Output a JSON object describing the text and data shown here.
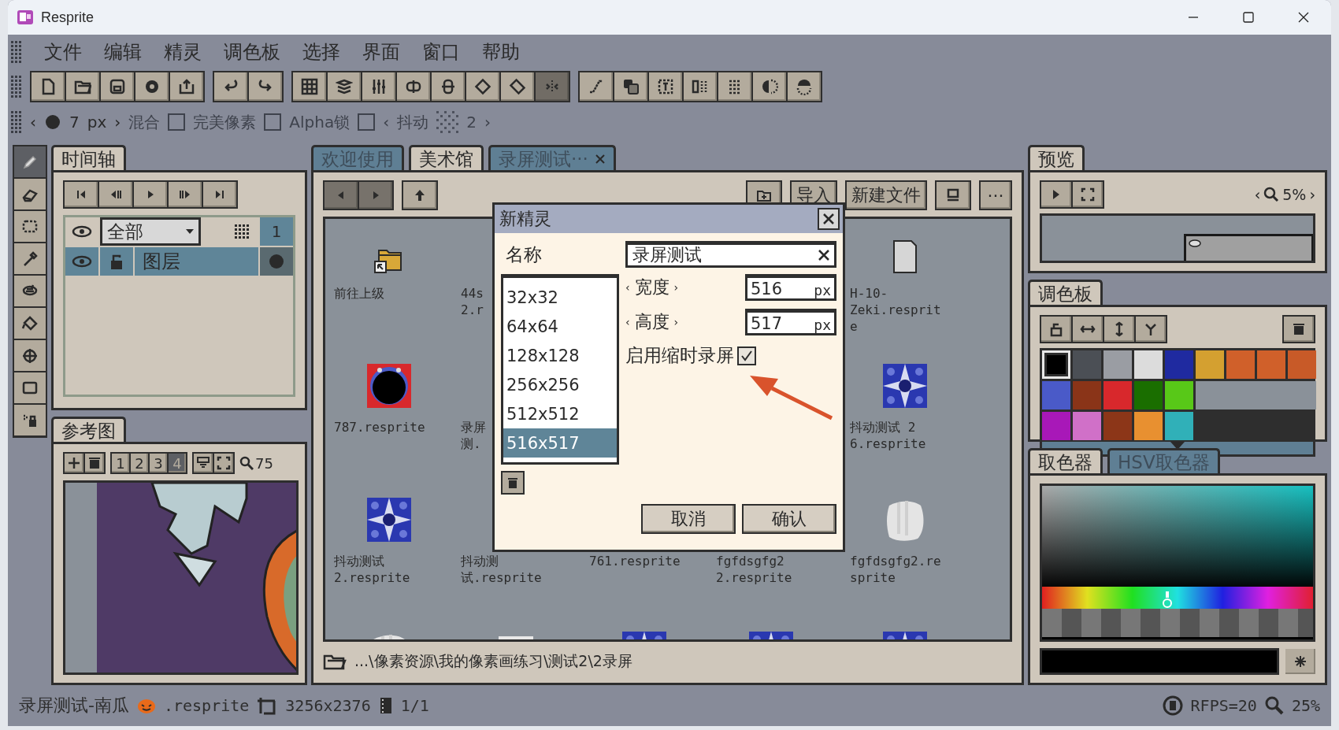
{
  "window": {
    "title": "Resprite"
  },
  "menu": [
    "文件",
    "编辑",
    "精灵",
    "调色板",
    "选择",
    "界面",
    "窗口",
    "帮助"
  ],
  "toolbar": [
    [
      {
        "disabled": false
      },
      {
        "disabled": false
      },
      {
        "disabled": false
      },
      {
        "disabled": false
      },
      {
        "disabled": false
      }
    ],
    [
      {
        "disabled": false
      },
      {
        "disabled": false
      }
    ],
    [
      {
        "disabled": false
      },
      {
        "disabled": false
      },
      {
        "disabled": false
      },
      {
        "disabled": false
      },
      {
        "disabled": false
      },
      {
        "disabled": false
      },
      {
        "disabled": false
      },
      {
        "disabled": true
      }
    ],
    [
      {
        "disabled": false
      },
      {
        "disabled": false
      },
      {
        "disabled": false
      },
      {
        "disabled": false
      },
      {
        "disabled": false
      },
      {
        "disabled": false
      },
      {
        "disabled": false
      }
    ]
  ],
  "options": {
    "arrows": [
      "‹",
      "›"
    ],
    "size": "7",
    "unit": "px",
    "checks": [
      {
        "label": "混合",
        "checked": false
      },
      {
        "label": "完美像素",
        "checked": false
      },
      {
        "label": "Alpha锁",
        "checked": false
      }
    ],
    "dither": {
      "arrows": [
        "‹",
        "›"
      ],
      "label": "抖动",
      "value": "2"
    }
  },
  "tools": [
    {
      "selected": true
    },
    {
      "selected": false
    },
    {
      "selected": false
    },
    {
      "selected": false
    },
    {
      "selected": false
    },
    {
      "selected": false
    },
    {
      "selected": false
    },
    {
      "selected": false
    },
    {
      "selected": false
    }
  ],
  "timeline": {
    "tab": "时间轴",
    "filter": "全部",
    "frames": [
      "1"
    ],
    "layers": [
      {
        "name": "图层",
        "selected": true,
        "visible": true,
        "locked": false
      }
    ]
  },
  "reference": {
    "tab": "参考图",
    "slots": [
      {
        "label": "1",
        "selected": false
      },
      {
        "label": "2",
        "selected": false
      },
      {
        "label": "3",
        "selected": false
      },
      {
        "label": "4",
        "selected": true
      }
    ],
    "zoom": "75"
  },
  "center": {
    "tabs": [
      {
        "label": "欢迎使用",
        "selected": false,
        "closable": false
      },
      {
        "label": "美术馆",
        "selected": true,
        "closable": false
      },
      {
        "label": "录屏测试···",
        "selected": false,
        "closable": true
      }
    ],
    "nav": [
      {
        "disabled": true
      },
      {
        "disabled": true
      },
      {
        "disabled": false
      }
    ],
    "actions": [
      {
        "kind": "icon"
      },
      {
        "kind": "text",
        "label": "导入"
      },
      {
        "kind": "text",
        "label": "新建文件"
      },
      {
        "kind": "icon"
      },
      {
        "kind": "text",
        "label": "···"
      }
    ],
    "file_rows": [
      [
        {
          "kind": "folder",
          "lines": [
            "前往上级"
          ]
        },
        {
          "kind": "name",
          "lines": [
            "44s",
            "2.r"
          ]
        },
        null,
        null,
        {
          "kind": "file",
          "lines": [
            "H-10-",
            "Zeki.resprit",
            "e"
          ]
        }
      ],
      [
        {
          "kind": "sprite",
          "lines": [
            "787.resprite"
          ]
        },
        {
          "kind": "name",
          "lines": [
            "录屏",
            "测."
          ]
        },
        null,
        null,
        {
          "kind": "sprite",
          "lines": [
            "抖动测试 2",
            "6.resprite"
          ]
        }
      ],
      [
        {
          "kind": "sprite",
          "lines": [
            "抖动测试",
            "2.resprite"
          ]
        },
        {
          "kind": "name",
          "lines": [
            "抖动测",
            "试.resprite"
          ]
        },
        {
          "kind": "name",
          "lines": [
            "761.resprite"
          ]
        },
        {
          "kind": "name",
          "lines": [
            "fgfdsgfg2",
            "2.resprite"
          ]
        },
        {
          "kind": "sprite",
          "lines": [
            "fgfdsgfg2.re",
            "sprite"
          ]
        }
      ],
      [
        {
          "kind": "sprite"
        },
        {
          "kind": "sprite"
        },
        {
          "kind": "sprite"
        },
        {
          "kind": "sprite"
        },
        {
          "kind": "sprite"
        }
      ]
    ],
    "path": "...\\像素资源\\我的像素画练习\\测试2\\2录屏"
  },
  "dialog": {
    "title": "新精灵",
    "name_label": "名称",
    "name_value": "录屏测试",
    "presets": [
      {
        "label": "32x32",
        "selected": false
      },
      {
        "label": "64x64",
        "selected": false
      },
      {
        "label": "128x128",
        "selected": false
      },
      {
        "label": "256x256",
        "selected": false
      },
      {
        "label": "512x512",
        "selected": false
      },
      {
        "label": "516x517",
        "selected": true
      }
    ],
    "dims": [
      {
        "arrows": [
          "‹",
          "›"
        ],
        "label": "宽度",
        "value": "516",
        "unit": "px"
      },
      {
        "arrows": [
          "‹",
          "›"
        ],
        "label": "高度",
        "value": "517",
        "unit": "px"
      }
    ],
    "timelapse": {
      "label": "启用缩时录屏",
      "checked": true
    },
    "buttons": [
      "取消",
      "确认"
    ]
  },
  "preview": {
    "tab": "预览",
    "arrows": [
      "‹",
      "›"
    ],
    "zoom": "5%"
  },
  "palette": {
    "tab": "调色板",
    "swatches": [
      {
        "color": "#000000",
        "selected": true
      },
      {
        "color": "#4b4f55",
        "selected": false
      },
      {
        "color": "#9a9da3",
        "selected": false
      },
      {
        "color": "#dcdcdc",
        "selected": false
      },
      {
        "color": "#1f2aa0",
        "selected": false
      },
      {
        "color": "#d4a030",
        "selected": false
      },
      {
        "color": "#d0602a",
        "selected": false
      },
      {
        "color": "#d0602a",
        "selected": false
      },
      {
        "color": "#c85a28",
        "selected": false
      },
      {
        "color": "#4a5ac8",
        "selected": false
      },
      {
        "color": "#8a3418",
        "selected": false
      },
      {
        "color": "#d8282c",
        "selected": false
      },
      {
        "color": "#1a6e00",
        "selected": false
      },
      {
        "color": "#58c818",
        "selected": false
      },
      {
        "color": "#a818b8",
        "selected": false
      },
      {
        "color": "#d070c8",
        "selected": false
      },
      {
        "color": "#8c3618",
        "selected": false
      },
      {
        "color": "#e89030",
        "selected": false
      },
      {
        "color": "#30b0b8",
        "selected": false
      }
    ]
  },
  "picker": {
    "tabs": [
      {
        "label": "取色器",
        "selected": true
      },
      {
        "label": "HSV取色器",
        "selected": false
      }
    ]
  },
  "status": {
    "file": "录屏测试-南瓜",
    "ext": ".resprite",
    "size": "3256x2376",
    "frames": "1/1",
    "fps": "RFPS=20",
    "zoom": "25%"
  }
}
